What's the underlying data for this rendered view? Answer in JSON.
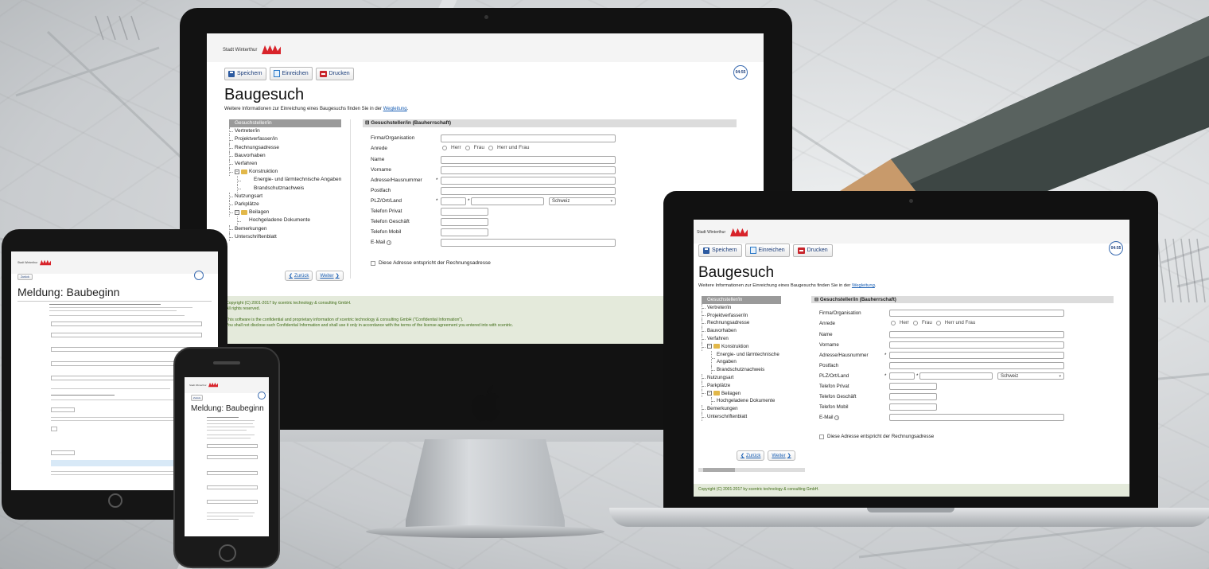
{
  "app": {
    "org_name": "Stadt Winterthur",
    "toolbar": {
      "save": "Speichern",
      "submit": "Einreichen",
      "print": "Drucken"
    },
    "timer": "04:55",
    "title": "Baugesuch",
    "intro_prefix": "Weitere Informationen zur Einreichung eines Baugesuchs finden Sie in der",
    "intro_link": "Wegleitung",
    "tree": {
      "applicant": "Gesuchsteller/in",
      "representative": "Vertreter/in",
      "planner": "Projektverfasser/in",
      "billing": "Rechnungsadresse",
      "project": "Bauvorhaben",
      "procedure": "Verfahren",
      "construction": "Konstruktion",
      "energy": "Energie- und lärmtechnische Angaben",
      "fire": "Brandschutznachweis",
      "usage": "Nutzungsart",
      "parking": "Parkplätze",
      "attachments": "Beilagen",
      "uploaded": "Hochgeladene Dokumente",
      "remarks": "Bemerkungen",
      "signature": "Unterschriftenblatt"
    },
    "nav": {
      "back": "Zurück",
      "next": "Weiter"
    },
    "section_title": "Gesuchsteller/in (Bauherrschaft)",
    "fields": {
      "company": "Firma/Organisation",
      "salutation": "Anrede",
      "mr": "Herr",
      "mrs": "Frau",
      "both": "Herr und Frau",
      "name": "Name",
      "firstname": "Vorname",
      "address": "Adresse/Hausnummer",
      "pobox": "Postfach",
      "zip_city_country": "PLZ/Ort/Land",
      "country_value": "Schweiz",
      "phone_private": "Telefon Privat",
      "phone_business": "Telefon Geschäft",
      "phone_mobile": "Telefon Mobil",
      "email": "E-Mail",
      "same_address": "Diese Adresse entspricht der Rechnungsadresse",
      "required_mark": "*"
    },
    "footer": {
      "copyright": "Copyright (C) 2001-2017 by xcentric technology & consulting GmbH.",
      "rights": "All rights reserved.",
      "notice1": "This software is the confidential and proprietary information of xcentric technology & consulting GmbH (\"Confidential Information\").",
      "notice2": "You shall not disclose such Confidential Information and shall use it only in accordance with the terms of the license agreement you entered into with xcentric."
    }
  },
  "mobile": {
    "title": "Meldung: Baubeginn",
    "back_button": "Zurück",
    "org_name": "Stadt Winterthur"
  },
  "colors": {
    "logo_red": "#d8232a",
    "link_blue": "#1a5fb4",
    "footer_green": "#3f6c16"
  }
}
